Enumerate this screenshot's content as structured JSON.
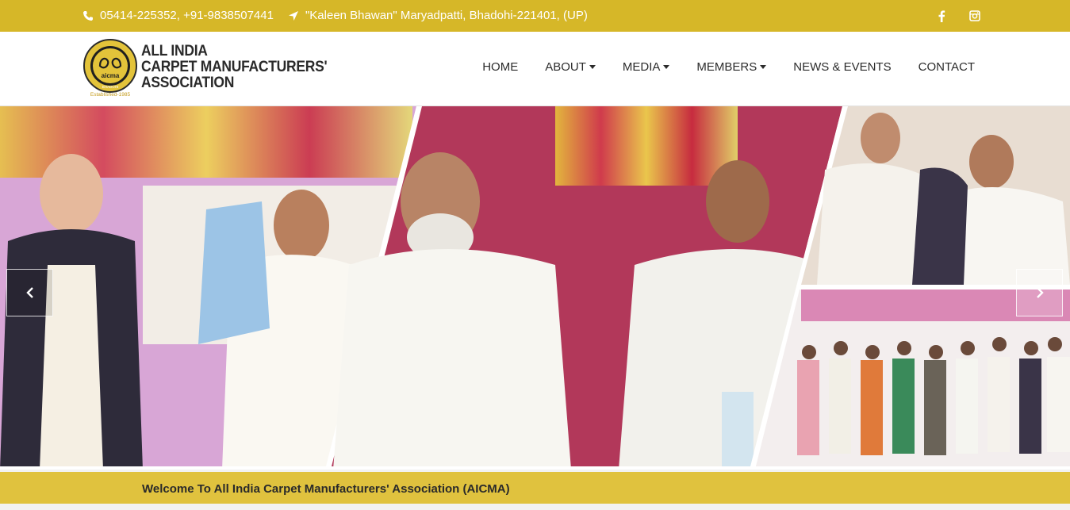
{
  "topbar": {
    "phone": "05414-225352, +91-9838507441",
    "address": "\"Kaleen Bhawan\" Maryadpatti, Bhadohi-221401, (UP)",
    "phone_icon": "phone-icon",
    "address_icon": "location-arrow-icon",
    "social": [
      {
        "name": "facebook-icon",
        "glyph": "f"
      },
      {
        "name": "instagram-icon",
        "glyph": "◻"
      }
    ]
  },
  "logo": {
    "line1": "ALL INDIA",
    "line2": "CARPET MANUFACTURERS'",
    "line3": "ASSOCIATION",
    "seal_text": "aicma",
    "seal_sub": "BHADOHI",
    "established": "Established-1985"
  },
  "nav": {
    "items": [
      {
        "label": "HOME",
        "dropdown": false
      },
      {
        "label": "ABOUT",
        "dropdown": true
      },
      {
        "label": "MEDIA",
        "dropdown": true
      },
      {
        "label": "MEMBERS",
        "dropdown": true
      },
      {
        "label": "NEWS & EVENTS",
        "dropdown": false
      },
      {
        "label": "CONTACT",
        "dropdown": false
      }
    ]
  },
  "slider": {
    "prev_icon": "chevron-left-icon",
    "next_icon": "chevron-right-icon"
  },
  "welcome": {
    "text": "Welcome To All India Carpet Manufacturers' Association (AICMA)"
  },
  "colors": {
    "brand": "#d6b728",
    "welcome_bar": "#e0c23e",
    "text": "#2b2b2b"
  }
}
